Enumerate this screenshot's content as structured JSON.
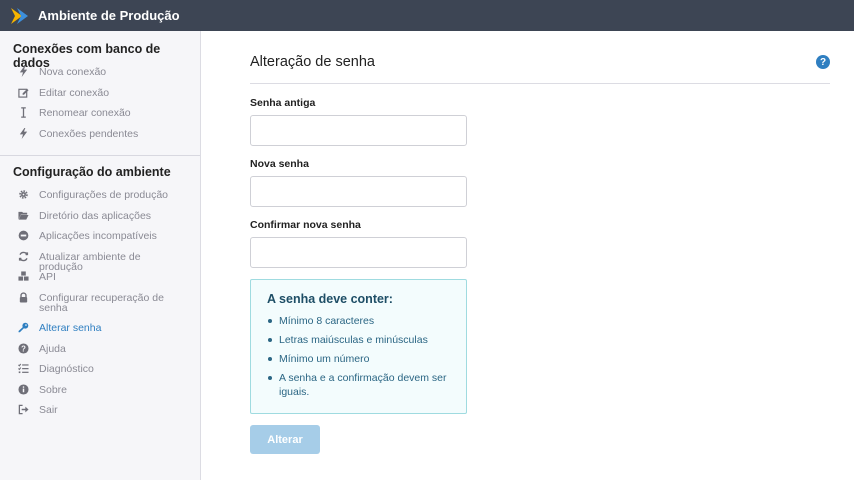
{
  "header": {
    "app_title": "Ambiente de Produção",
    "logo_colors": [
      "#f5b400",
      "#3d8fdb"
    ]
  },
  "sidebar": {
    "section1": {
      "title": "Conexões com banco de dados",
      "items": [
        {
          "label": "Nova conexão",
          "icon": "bolt-icon"
        },
        {
          "label": "Editar conexão",
          "icon": "edit-icon"
        },
        {
          "label": "Renomear conexão",
          "icon": "text-cursor-icon"
        },
        {
          "label": "Conexões pendentes",
          "icon": "bolt-icon"
        }
      ]
    },
    "section2": {
      "title": "Configuração do ambiente",
      "items": [
        {
          "label": "Configurações de produção",
          "icon": "gear-icon"
        },
        {
          "label": "Diretório das aplicações",
          "icon": "folder-open-icon"
        },
        {
          "label": "Aplicações incompatíveis",
          "icon": "ban-icon"
        },
        {
          "label": "Atualizar ambiente de produção",
          "icon": "refresh-icon"
        },
        {
          "label": "API",
          "icon": "cubes-icon"
        },
        {
          "label": "Configurar recuperação de senha",
          "icon": "lock-icon"
        },
        {
          "label": "Alterar senha",
          "icon": "key-icon",
          "active": true
        },
        {
          "label": "Ajuda",
          "icon": "question-circle-icon"
        },
        {
          "label": "Diagnóstico",
          "icon": "list-check-icon"
        },
        {
          "label": "Sobre",
          "icon": "info-circle-icon"
        },
        {
          "label": "Sair",
          "icon": "sign-out-icon"
        }
      ]
    }
  },
  "main": {
    "title": "Alteração de senha",
    "help_icon": "question-circle-icon",
    "fields": {
      "old_password": {
        "label": "Senha antiga",
        "value": ""
      },
      "new_password": {
        "label": "Nova senha",
        "value": ""
      },
      "confirm_password": {
        "label": "Confirmar nova senha",
        "value": ""
      }
    },
    "requirements": {
      "title": "A senha deve conter:",
      "items": [
        "Mínimo 8 caracteres",
        "Letras maiúsculas e minúsculas",
        "Mínimo um número",
        "A senha e a confirmação devem ser iguais."
      ]
    },
    "submit_label": "Alterar"
  },
  "colors": {
    "topbar": "#3d4554",
    "accent": "#2f7fc1",
    "active_nav": "#2f7fc1",
    "button_disabled": "#a6cde8",
    "requirements_bg": "#f3fcfd",
    "requirements_border": "#9fdbe0"
  }
}
